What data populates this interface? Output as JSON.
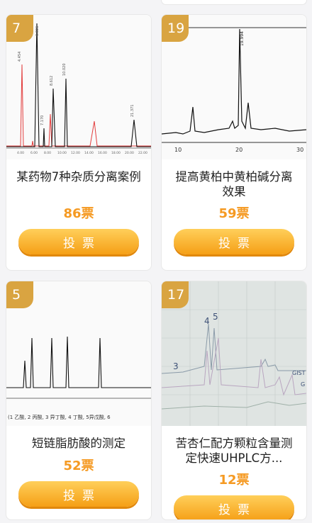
{
  "cards": [
    {
      "rank": "7",
      "title": "某药物7种杂质分离案例",
      "votes": "86票",
      "button": "投票",
      "chart_labels": {
        "peaks": [
          "4.454",
          "6.326",
          "7.170",
          "8.612",
          "10.020",
          "21.371"
        ],
        "axis": [
          "4.00",
          "6.00",
          "8.00",
          "10.00",
          "12.00",
          "14.00",
          "16.00",
          "18.00",
          "20.00",
          "22.00"
        ]
      }
    },
    {
      "rank": "19",
      "title": "提高黄柏中黄柏碱分离效果",
      "votes": "59票",
      "button": "投票",
      "chart_labels": {
        "peaks": [
          "19.994"
        ],
        "axis": [
          "10",
          "20",
          "30"
        ]
      }
    },
    {
      "rank": "5",
      "title": "短链脂肪酸的测定",
      "votes": "52票",
      "button": "投票",
      "chart_labels": {
        "caption": "(1 乙酸, 2 丙酸, 3 异丁酸, 4 丁酸, 5异戊酸, 6"
      }
    },
    {
      "rank": "17",
      "title": "苦杏仁配方颗粒含量测定快速UHPLC方...",
      "votes": "12票",
      "button": "投票",
      "chart_labels": {
        "peaks": [
          "3",
          "4",
          "5"
        ],
        "side": [
          "GIST",
          "G"
        ]
      }
    }
  ],
  "colors": {
    "accent": "#f59a23",
    "badge": "#d9a441",
    "button": "#f8b430"
  }
}
